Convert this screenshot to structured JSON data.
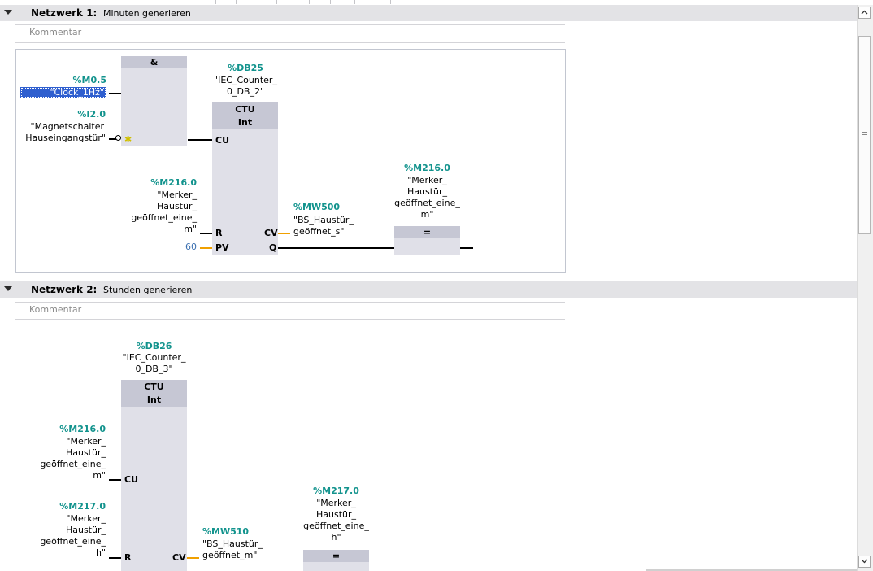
{
  "network1": {
    "label": "Netzwerk 1:",
    "title": "Minuten generieren",
    "comment": "Kommentar",
    "and_block": {
      "label": "&"
    },
    "in_a": {
      "address": "%M0.5",
      "name": "\"Clock_1Hz\""
    },
    "in_b": {
      "address": "%I2.0",
      "name_line1": "\"Magnetschalter",
      "name_line2": "Hauseingangstür\""
    },
    "counter": {
      "db_address": "%DB25",
      "db_line1": "\"IEC_Counter_",
      "db_line2": "0_DB_2\"",
      "type": "CTU",
      "datatype": "Int",
      "pin_cu": "CU",
      "pin_r": "R",
      "pin_pv": "PV",
      "pin_cv": "CV",
      "pin_q": "Q",
      "r_address": "%M216.0",
      "r_line1": "\"Merker_",
      "r_line2": "Haustür_",
      "r_line3": "geöffnet_eine_",
      "r_line4": "m\"",
      "pv_value": "60",
      "cv_address": "%MW500",
      "cv_line1": "\"BS_Haustür_",
      "cv_line2": "geöffnet_s\""
    },
    "coil": {
      "address": "%M216.0",
      "line1": "\"Merker_",
      "line2": "Haustür_",
      "line3": "geöffnet_eine_",
      "line4": "m\"",
      "symbol": "="
    }
  },
  "network2": {
    "label": "Netzwerk 2:",
    "title": "Stunden generieren",
    "comment": "Kommentar",
    "counter": {
      "db_address": "%DB26",
      "db_line1": "\"IEC_Counter_",
      "db_line2": "0_DB_3\"",
      "type": "CTU",
      "datatype": "Int",
      "pin_cu": "CU",
      "pin_r": "R",
      "pin_cv": "CV",
      "cu_address": "%M216.0",
      "cu_line1": "\"Merker_",
      "cu_line2": "Haustür_",
      "cu_line3": "geöffnet_eine_",
      "cu_line4": "m\"",
      "r_address": "%M217.0",
      "r_line1": "\"Merker_",
      "r_line2": "Haustür_",
      "r_line3": "geöffnet_eine_",
      "r_line4": "h\"",
      "cv_address": "%MW510",
      "cv_line1": "\"BS_Haustür_",
      "cv_line2": "geöffnet_m\""
    },
    "coil": {
      "address": "%M217.0",
      "line1": "\"Merker_",
      "line2": "Haustür_",
      "line3": "geöffnet_eine_",
      "line4": "h\"",
      "symbol": "="
    }
  },
  "scrollbar": {
    "up_icon": "chevron-up-icon",
    "down_icon": "chevron-down-icon",
    "grip_icon": "grip-lines-icon"
  },
  "colors": {
    "address": "#12938d",
    "selection": "#2f5fcf",
    "block": "#e0e0e8",
    "block_header": "#c6c7d4",
    "orange_wire": "#f0a000"
  }
}
